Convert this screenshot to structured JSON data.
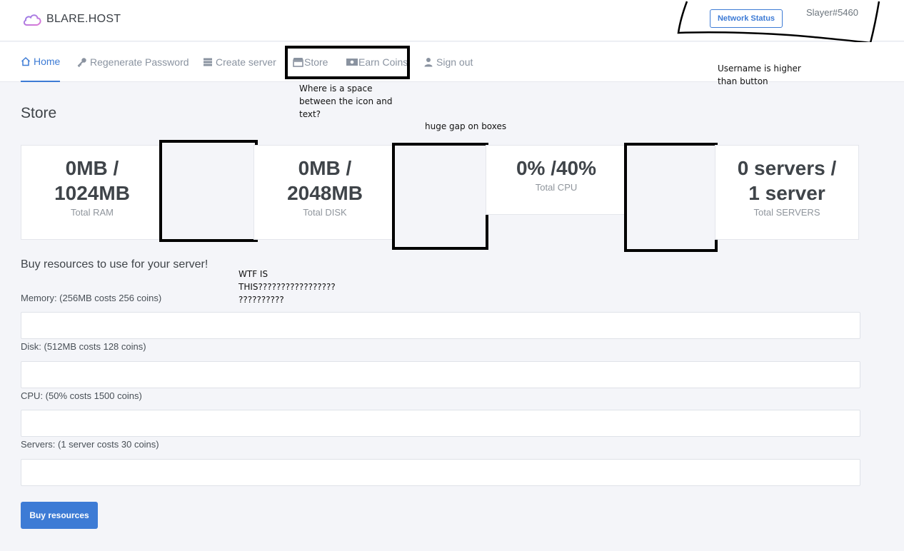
{
  "brand": {
    "name": "BLARE.HOST"
  },
  "header": {
    "network_status": "Network Status",
    "username": "Slayer#5460"
  },
  "nav": {
    "items": [
      {
        "label": "Home",
        "icon": "home-icon",
        "active": true
      },
      {
        "label": "Regenerate Password",
        "icon": "key-icon"
      },
      {
        "label": "Create server",
        "icon": "server-icon"
      },
      {
        "label": "Store",
        "icon": "store-icon"
      },
      {
        "label": "Earn Coins",
        "icon": "money-bill-icon"
      },
      {
        "label": "Sign out",
        "icon": "user-icon"
      }
    ]
  },
  "annotations": {
    "icon_space": "Where is a space\nbetween the icon and\ntext?",
    "username": "Username is higher\nthan button",
    "gap": "huge gap on boxes",
    "wtf": "WTF IS\nTHIS?????????????????\n??????????"
  },
  "page": {
    "title": "Store"
  },
  "stats": [
    {
      "value": "0MB /\n1024MB",
      "line1": "0MB /",
      "line2": "1024MB",
      "label": "Total RAM"
    },
    {
      "line1": "0MB /",
      "line2": "2048MB",
      "label": "Total DISK"
    },
    {
      "line1": "0% /40%",
      "label": "Total CPU"
    },
    {
      "line1": "0 servers /",
      "line2": "1 server",
      "label": "Total SERVERS"
    }
  ],
  "form": {
    "heading": "Buy resources to use for your server!",
    "memory_label": "Memory: (256MB costs 256 coins)",
    "disk_label": "Disk: (512MB costs 128 coins)",
    "cpu_label": "CPU: (50% costs 1500 coins)",
    "servers_label": "Servers: (1 server costs 30 coins)",
    "memory_value": "",
    "disk_value": "",
    "cpu_value": "",
    "servers_value": "",
    "buy_label": "Buy resources"
  },
  "colors": {
    "accent": "#3d7bd5",
    "background": "#f4f5f9",
    "card": "#ffffff"
  }
}
